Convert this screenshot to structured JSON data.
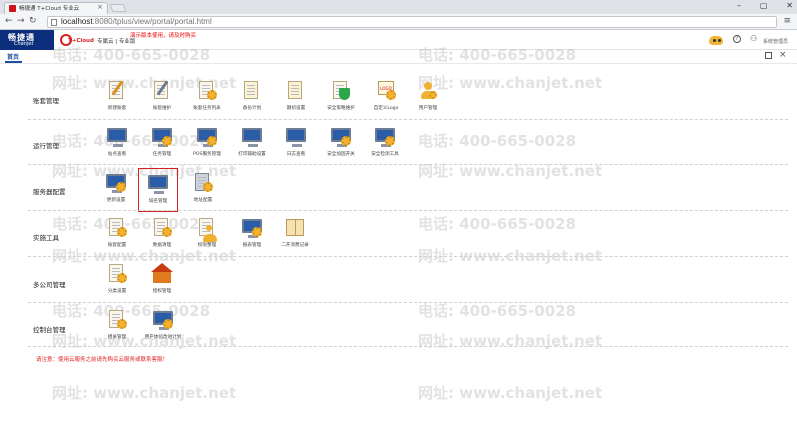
{
  "browser": {
    "tab_title": "畅捷通 T+Cloud 专业云",
    "tab_close": "×",
    "url_host": "localhost",
    "url_rest": ":8080/tplus/view/portal/portal.html",
    "window_controls": [
      "–",
      "▢",
      "✕"
    ]
  },
  "header": {
    "logo_cn": "畅捷通",
    "logo_en": "Chanjet",
    "product_logo": "T+Cloud",
    "edition": "专属云 | 专业版",
    "notice": "演示版本使用，请及时购买",
    "username": "系统管理员"
  },
  "tabs": {
    "home": "首页"
  },
  "watermark": {
    "phone": "电话: 400-665-0028",
    "site": "网址: www.chanjet.net"
  },
  "sections": [
    {
      "title": "账套管理",
      "items": [
        {
          "label": "新建账套",
          "icon": "new-account-icon"
        },
        {
          "label": "账套维护",
          "icon": "account-maintenance-icon"
        },
        {
          "label": "账套任务列表",
          "icon": "task-list-icon"
        },
        {
          "label": "备份计划",
          "icon": "backup-plan-icon"
        },
        {
          "label": "期初设置",
          "icon": "opening-setup-icon"
        },
        {
          "label": "安全策略维护",
          "icon": "security-policy-icon"
        },
        {
          "label": "自定义Logo",
          "icon": "custom-logo-icon"
        },
        {
          "label": "用户管理",
          "icon": "user-management-icon"
        }
      ]
    },
    {
      "title": "运行管理",
      "items": [
        {
          "label": "站点查看",
          "icon": "site-view-icon"
        },
        {
          "label": "任务管理",
          "icon": "task-management-icon"
        },
        {
          "label": "POS服务管理",
          "icon": "pos-service-icon"
        },
        {
          "label": "打印辅助设置",
          "icon": "print-settings-icon"
        },
        {
          "label": "日志查看",
          "icon": "log-view-icon"
        },
        {
          "label": "安全加固开关",
          "icon": "security-switch-icon"
        },
        {
          "label": "安全检测工具",
          "icon": "security-check-icon"
        }
      ]
    },
    {
      "title": "服务器配置",
      "items": [
        {
          "label": "更新设置",
          "icon": "update-settings-icon"
        },
        {
          "label": "域名管理",
          "icon": "domain-management-icon"
        },
        {
          "label": "地址配置",
          "icon": "address-config-icon"
        }
      ]
    },
    {
      "title": "实施工具",
      "items": [
        {
          "label": "账套配置",
          "icon": "account-config-icon"
        },
        {
          "label": "数据清理",
          "icon": "data-cleanup-icon"
        },
        {
          "label": "权限整理",
          "icon": "permission-icon"
        },
        {
          "label": "报表管理",
          "icon": "report-management-icon"
        },
        {
          "label": "二开消费记录",
          "icon": "dev-record-icon"
        }
      ]
    },
    {
      "title": "多公司管理",
      "items": [
        {
          "label": "分类设置",
          "icon": "category-settings-icon"
        },
        {
          "label": "授权管理",
          "icon": "license-management-icon"
        }
      ]
    },
    {
      "title": "控制台管理",
      "items": [
        {
          "label": "相关管理",
          "icon": "related-management-icon"
        },
        {
          "label": "用户体验改进计划",
          "icon": "ux-improvement-icon"
        }
      ]
    }
  ],
  "footnote": "请注意：使用云服务之前请先购买云服务或联系客服！"
}
